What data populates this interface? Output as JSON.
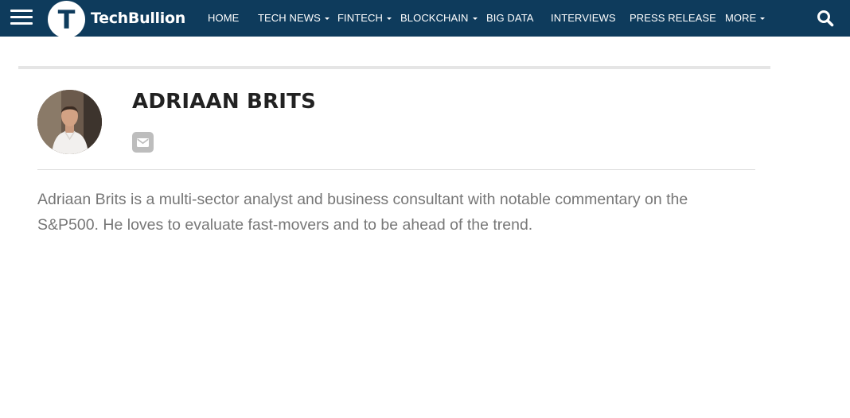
{
  "header": {
    "logo_text": "TechBullion",
    "logo_letter": "T",
    "nav": [
      {
        "label": "HOME",
        "dropdown": false
      },
      {
        "label": "TECH NEWS",
        "dropdown": true
      },
      {
        "label": "FINTECH",
        "dropdown": true
      },
      {
        "label": "BLOCKCHAIN",
        "dropdown": true
      },
      {
        "label": "BIG DATA",
        "dropdown": false
      },
      {
        "label": "INTERVIEWS",
        "dropdown": false
      },
      {
        "label": "PRESS RELEASE",
        "dropdown": false
      },
      {
        "label": "MORE",
        "dropdown": true
      }
    ],
    "menu_icon": "hamburger-icon",
    "search_icon": "search-icon"
  },
  "author": {
    "name": "ADRIAAN BRITS",
    "email_icon": "envelope-icon",
    "bio": "Adriaan Brits is a multi-sector analyst and business consultant with notable commentary on the S&P500. He loves to evaluate fast-movers and to be ahead of the trend."
  },
  "colors": {
    "nav_background": "#0e3b5c",
    "nav_text": "#ffffff",
    "name_text": "#222222",
    "bio_text": "#777777",
    "email_button": "#bdbdbd"
  }
}
